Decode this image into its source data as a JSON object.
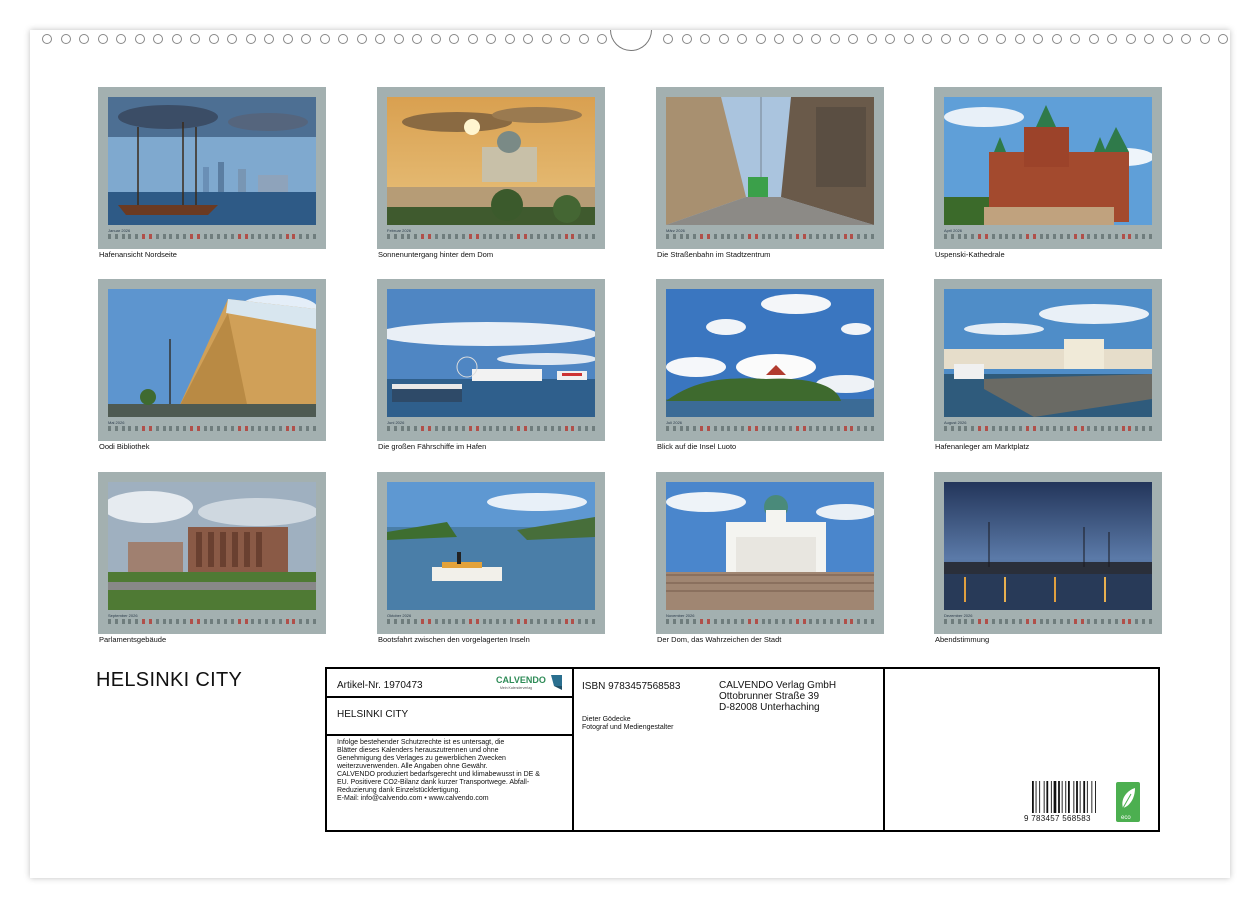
{
  "calendar": {
    "title": "HELSINKI CITY",
    "months": [
      {
        "caption": "Hafenansicht Nordseite",
        "month_label": "Januar 2026",
        "image": "tall-ships-harbor-photo"
      },
      {
        "caption": "Sonnenuntergang hinter dem Dom",
        "month_label": "Februar 2026",
        "image": "cathedral-sunset-photo"
      },
      {
        "caption": "Die Straßenbahn im Stadtzentrum",
        "month_label": "März 2026",
        "image": "tram-street-photo"
      },
      {
        "caption": "Uspenski-Kathedrale",
        "month_label": "April 2026",
        "image": "uspenski-cathedral-photo"
      },
      {
        "caption": "Oodi Bibliothek",
        "month_label": "Mai 2026",
        "image": "oodi-library-photo"
      },
      {
        "caption": "Die großen Fährschiffe im Hafen",
        "month_label": "Juni 2026",
        "image": "ferries-harbor-photo"
      },
      {
        "caption": "Blick auf die Insel Luoto",
        "month_label": "Juli 2026",
        "image": "luoto-island-photo"
      },
      {
        "caption": "Hafenanleger am Marktplatz",
        "month_label": "August 2026",
        "image": "market-pier-photo"
      },
      {
        "caption": "Parlamentsgebäude",
        "month_label": "September 2026",
        "image": "parliament-building-photo"
      },
      {
        "caption": "Bootsfahrt zwischen den vorgelagerten Inseln",
        "month_label": "Oktober 2026",
        "image": "boat-trip-photo"
      },
      {
        "caption": "Der Dom, das Wahrzeichen der Stadt",
        "month_label": "November 2026",
        "image": "cathedral-steps-photo"
      },
      {
        "caption": "Abendstimmung",
        "month_label": "Dezember 2026",
        "image": "evening-harbor-photo"
      }
    ]
  },
  "info": {
    "article_no": "Artikel-Nr. 1970473",
    "logo_text": "CALVENDO",
    "logo_subtext": "Mein Kalenderverlag",
    "title": "HELSINKI CITY",
    "legal_lines": [
      "Infolge bestehender Schutzrechte ist es untersagt, die",
      "Blätter dieses Kalenders herauszutrennen und ohne",
      "Genehmigung des Verlages zu gewerblichen Zwecken",
      "weiterzuverwenden. Alle Angaben ohne Gewähr.",
      "CALVENDO produziert bedarfsgerecht und klimabewusst in DE &",
      "EU. Positivere CO2-Bilanz dank kurzer Transportwege. Abfall-",
      "Reduzierung dank Einzelstückfertigung.",
      "E-Mail: info@calvendo.com • www.calvendo.com"
    ],
    "isbn": "ISBN 9783457568583",
    "publisher_lines": [
      "CALVENDO Verlag GmbH",
      "Ottobrunner Straße 39",
      "D-82008 Unterhaching"
    ],
    "author_lines": [
      "Dieter Gödecke",
      "Fotograf und Mediengestalter"
    ],
    "barcode_number": "9 783457 568583",
    "eco_label": "eco"
  },
  "colors": {
    "frame": "#a3b0b0",
    "weekend": "#b0504a",
    "eco": "#4caf50"
  }
}
